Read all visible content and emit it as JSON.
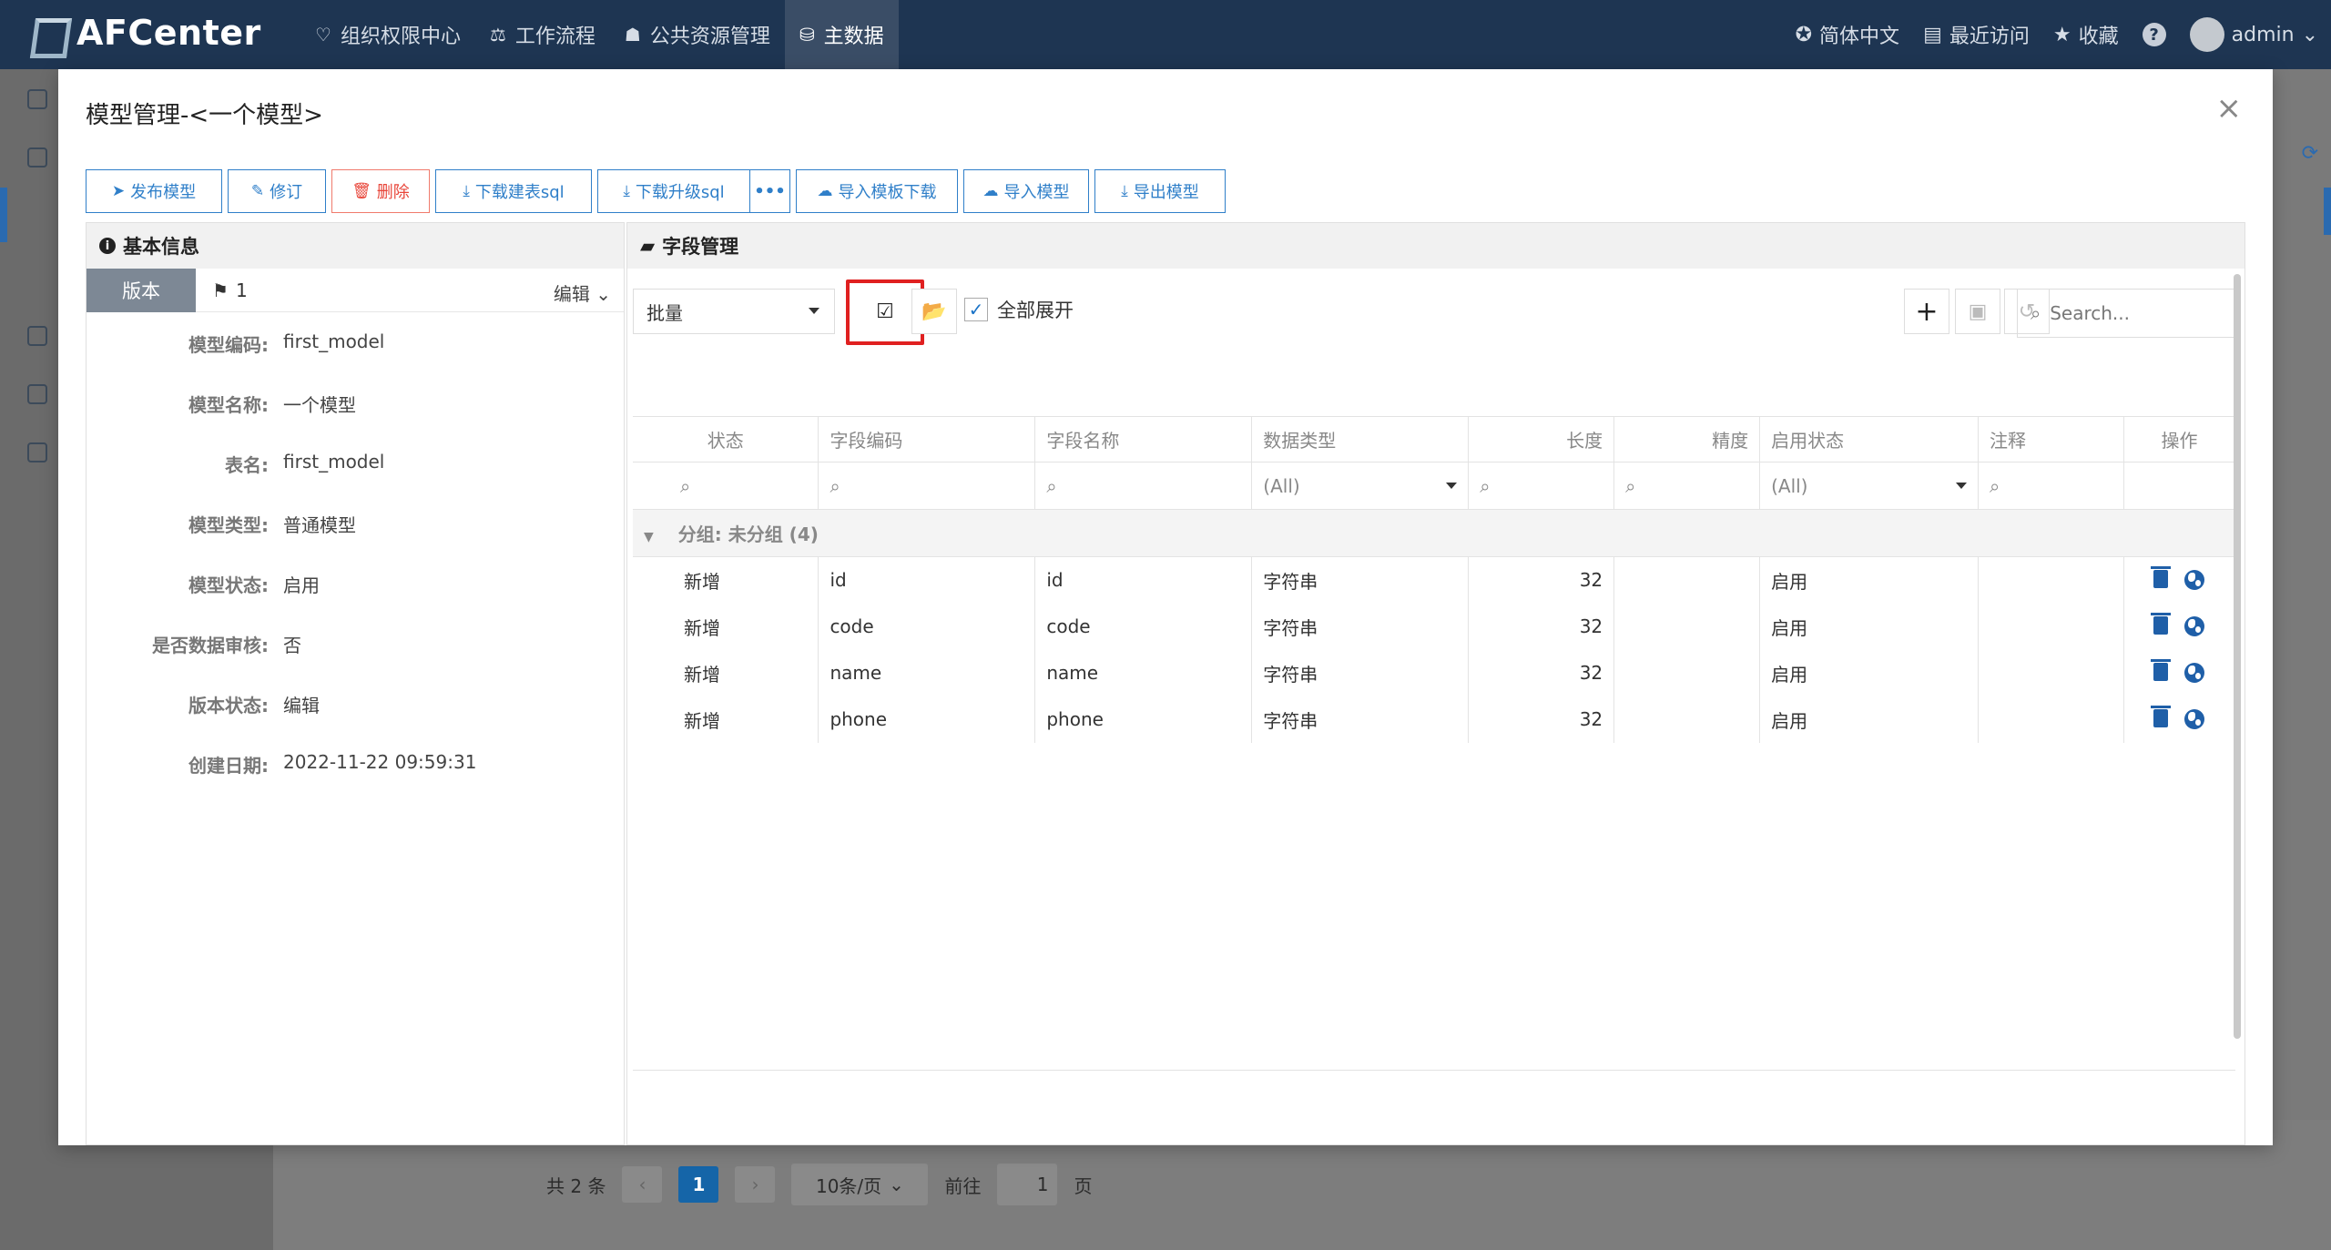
{
  "app": {
    "brand": "AFCenter",
    "nav": [
      {
        "icon": "heart-shield-icon",
        "glyph": "♡",
        "label": "组织权限中心"
      },
      {
        "icon": "scale-icon",
        "glyph": "⚖",
        "label": "工作流程"
      },
      {
        "icon": "users-icon",
        "glyph": "☗",
        "label": "公共资源管理"
      },
      {
        "icon": "data-icon",
        "glyph": "⛁",
        "label": "主数据"
      }
    ],
    "right": {
      "language": "简体中文",
      "recent": "最近访问",
      "favorites": "收藏",
      "help": "?",
      "user": "admin"
    }
  },
  "pager": {
    "total": "共 2 条",
    "prev": "‹",
    "current": "1",
    "next": "›",
    "page_size": "10条/页",
    "goto_label": "前往",
    "goto_value": "1",
    "goto_suffix": "页"
  },
  "modal": {
    "title": "模型管理-<一个模型>",
    "close": "×",
    "toolbar": [
      {
        "name": "publish-model-button",
        "icon": "send-icon",
        "glyph": "➤",
        "label": "发布模型"
      },
      {
        "name": "revise-button",
        "icon": "edit-icon",
        "glyph": "✎",
        "label": "修订"
      },
      {
        "name": "delete-button",
        "icon": "trash-icon",
        "glyph": "🗑",
        "label": "删除",
        "danger": true
      },
      {
        "name": "download-create-sql-button",
        "icon": "download-icon",
        "glyph": "⤓",
        "label": "下载建表sql"
      },
      {
        "name": "download-upgrade-sql-button",
        "icon": "download-icon",
        "glyph": "⤓",
        "label": "下载升级sql"
      },
      {
        "name": "more-button",
        "icon": "more-icon",
        "glyph": "•••",
        "label": ""
      },
      {
        "name": "import-template-download-button",
        "icon": "cloud-icon",
        "glyph": "☁",
        "label": "导入模板下载"
      },
      {
        "name": "import-model-button",
        "icon": "cloud-upload-icon",
        "glyph": "☁",
        "label": "导入模型"
      },
      {
        "name": "export-model-button",
        "icon": "download-icon",
        "glyph": "⤓",
        "label": "导出模型"
      }
    ]
  },
  "basic": {
    "title": "基本信息",
    "version_tab": "版本",
    "version_value": "1",
    "edit_label": "编辑",
    "fields": [
      {
        "label": "模型编码:",
        "value": "first_model"
      },
      {
        "label": "模型名称:",
        "value": "一个模型"
      },
      {
        "label": "表名:",
        "value": "first_model"
      },
      {
        "label": "模型类型:",
        "value": "普通模型"
      },
      {
        "label": "模型状态:",
        "value": "启用"
      },
      {
        "label": "是否数据审核:",
        "value": "否"
      },
      {
        "label": "版本状态:",
        "value": "编辑"
      },
      {
        "label": "创建日期:",
        "value": "2022-11-22 09:59:31"
      }
    ]
  },
  "fields_panel": {
    "title": "字段管理",
    "batch": "批量",
    "expand_all": "全部展开",
    "search_placeholder": "Search...",
    "columns": [
      "状态",
      "字段编码",
      "字段名称",
      "数据类型",
      "长度",
      "精度",
      "启用状态",
      "注释",
      "操作"
    ],
    "filter_all": "(All)",
    "group_label": "分组: 未分组 (4)",
    "rows": [
      {
        "status": "新增",
        "code": "id",
        "name": "id",
        "type": "字符串",
        "length": "32",
        "precision": "",
        "enabled": "启用",
        "comment": ""
      },
      {
        "status": "新增",
        "code": "code",
        "name": "code",
        "type": "字符串",
        "length": "32",
        "precision": "",
        "enabled": "启用",
        "comment": ""
      },
      {
        "status": "新增",
        "code": "name",
        "name": "name",
        "type": "字符串",
        "length": "32",
        "precision": "",
        "enabled": "启用",
        "comment": ""
      },
      {
        "status": "新增",
        "code": "phone",
        "name": "phone",
        "type": "字符串",
        "length": "32",
        "precision": "",
        "enabled": "启用",
        "comment": ""
      }
    ]
  }
}
